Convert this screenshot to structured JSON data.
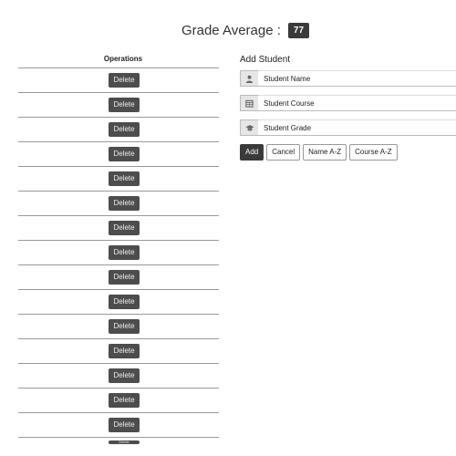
{
  "header": {
    "title": "Grade Average :",
    "grade_average": "77"
  },
  "table": {
    "column_header": "Operations",
    "delete_label": "Delete",
    "row_count": 15
  },
  "form": {
    "title": "Add Student",
    "fields": {
      "name": {
        "placeholder": "Student Name",
        "icon": "user-icon"
      },
      "course": {
        "placeholder": "Student Course",
        "icon": "calendar-icon"
      },
      "grade": {
        "placeholder": "Student Grade",
        "icon": "graduation-cap-icon"
      }
    },
    "buttons": {
      "add": "Add",
      "cancel": "Cancel",
      "sort_name": "Name A-Z",
      "sort_course": "Course A-Z"
    }
  },
  "colors": {
    "dark": "#3a3a3a",
    "button_gray": "#4d4d4d",
    "border": "#999999"
  }
}
